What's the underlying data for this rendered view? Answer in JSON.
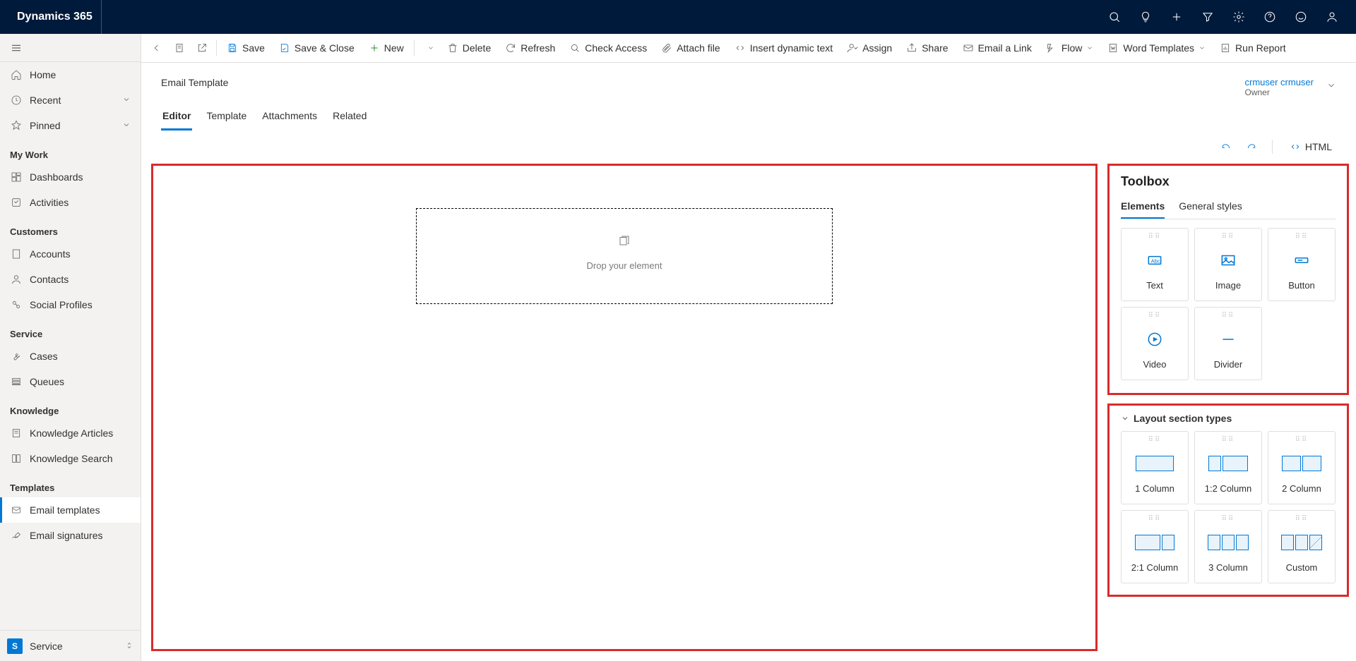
{
  "brand": "Dynamics 365",
  "sidebar": {
    "home": "Home",
    "recent": "Recent",
    "pinned": "Pinned",
    "sections": {
      "mywork": {
        "label": "My Work",
        "dashboards": "Dashboards",
        "activities": "Activities"
      },
      "customers": {
        "label": "Customers",
        "accounts": "Accounts",
        "contacts": "Contacts",
        "social": "Social Profiles"
      },
      "service": {
        "label": "Service",
        "cases": "Cases",
        "queues": "Queues"
      },
      "knowledge": {
        "label": "Knowledge",
        "articles": "Knowledge Articles",
        "search": "Knowledge Search"
      },
      "templates": {
        "label": "Templates",
        "email": "Email templates",
        "signatures": "Email signatures"
      }
    },
    "area": {
      "badge": "S",
      "label": "Service"
    }
  },
  "commands": {
    "save": "Save",
    "saveclose": "Save & Close",
    "new": "New",
    "delete": "Delete",
    "refresh": "Refresh",
    "checkaccess": "Check Access",
    "attach": "Attach file",
    "dynamic": "Insert dynamic text",
    "assign": "Assign",
    "share": "Share",
    "emaillink": "Email a Link",
    "flow": "Flow",
    "wordtemplates": "Word Templates",
    "runreport": "Run Report"
  },
  "record": {
    "title": "Email Template",
    "owner_name": "crmuser crmuser",
    "owner_label": "Owner"
  },
  "tabs": {
    "editor": "Editor",
    "template": "Template",
    "attachments": "Attachments",
    "related": "Related"
  },
  "editor_toolbar": {
    "html": "HTML"
  },
  "canvas": {
    "drop_text": "Drop your element"
  },
  "toolbox": {
    "title": "Toolbox",
    "tabs": {
      "elements": "Elements",
      "styles": "General styles"
    },
    "tiles": {
      "text": "Text",
      "image": "Image",
      "button": "Button",
      "video": "Video",
      "divider": "Divider"
    }
  },
  "layouts": {
    "title": "Layout section types",
    "c1": "1 Column",
    "c12": "1:2 Column",
    "c2": "2 Column",
    "c21": "2:1 Column",
    "c3": "3 Column",
    "custom": "Custom"
  }
}
